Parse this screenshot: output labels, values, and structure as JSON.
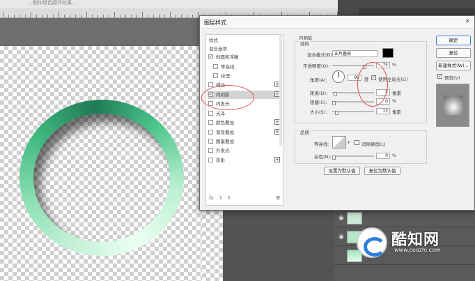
{
  "top_strip_text": "…制作绿色圆环效果…",
  "dialog": {
    "title": "图层样式",
    "close_icon": "close-icon"
  },
  "styles_list": {
    "header": "样式",
    "items": [
      {
        "label": "混合选项",
        "checkbox": false,
        "checked": false,
        "plus": false
      },
      {
        "label": "斜面和浮雕",
        "checkbox": true,
        "checked": true,
        "plus": false
      },
      {
        "label": "等高线",
        "checkbox": true,
        "checked": false,
        "plus": false,
        "indent": true
      },
      {
        "label": "纹理",
        "checkbox": true,
        "checked": false,
        "plus": false,
        "indent": true
      },
      {
        "label": "描边",
        "checkbox": true,
        "checked": false,
        "plus": true
      },
      {
        "label": "内阴影",
        "checkbox": true,
        "checked": true,
        "plus": true,
        "selected": true
      },
      {
        "label": "内发光",
        "checkbox": true,
        "checked": false,
        "plus": false
      },
      {
        "label": "光泽",
        "checkbox": true,
        "checked": false,
        "plus": false
      },
      {
        "label": "颜色叠加",
        "checkbox": true,
        "checked": false,
        "plus": true
      },
      {
        "label": "渐变叠加",
        "checkbox": true,
        "checked": false,
        "plus": true
      },
      {
        "label": "图案叠加",
        "checkbox": true,
        "checked": false,
        "plus": false
      },
      {
        "label": "外发光",
        "checkbox": true,
        "checked": false,
        "plus": false
      },
      {
        "label": "投影",
        "checkbox": true,
        "checked": false,
        "plus": true
      }
    ],
    "bottom_fx": "fx",
    "bottom_up": "⇧",
    "bottom_down": "⇩",
    "bottom_trash": "🗑"
  },
  "inner_shadow": {
    "section_title": "内阴影",
    "structure_title": "结构",
    "blend_mode_label": "混合模式(B):",
    "blend_mode_value": "正片叠底",
    "opacity_label": "不透明度(O):",
    "opacity_value": "75",
    "angle_label": "角度(A):",
    "angle_value": "90",
    "angle_unit": "度",
    "global_light_label": "使用全局光(G)",
    "distance_label": "距离(D):",
    "distance_value": "5",
    "choke_label": "阻塞(C):",
    "choke_value": "0",
    "size_label": "大小(S):",
    "size_value": "13",
    "px_unit": "像素",
    "pct_unit": "%",
    "quality_title": "品质",
    "contour_label": "等高线:",
    "antialias_label": "消除锯齿(L)",
    "noise_label": "杂色(N):",
    "noise_value": "0",
    "set_default_btn": "设置为默认值",
    "reset_default_btn": "复位为默认值"
  },
  "right_buttons": {
    "ok": "确定",
    "reset": "复位",
    "new_style": "新建样式(W)...",
    "preview_label": "预览(V)"
  },
  "watermark": {
    "title": "酷知网",
    "url": "www.coozhi.com"
  },
  "colors": {
    "shadow_swatch": "#000000",
    "annotation_circle": "#e0505a",
    "ring_green": "#3fb880"
  }
}
